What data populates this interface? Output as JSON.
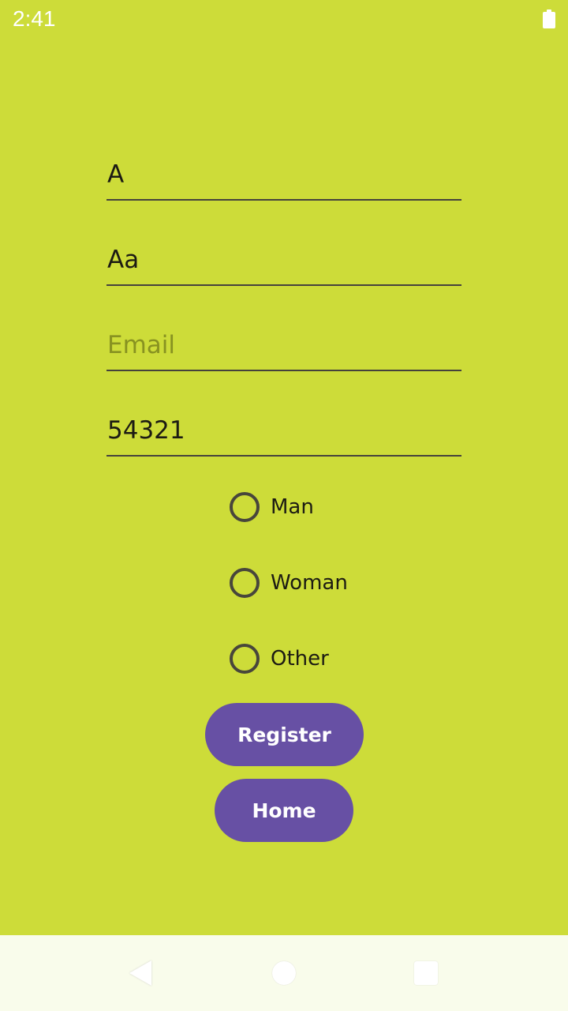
{
  "status_bar": {
    "time": "2:41",
    "battery_icon": "battery-full-icon"
  },
  "form": {
    "fields": [
      {
        "name": "first-name",
        "value": "A",
        "placeholder": ""
      },
      {
        "name": "last-name",
        "value": "Aa",
        "placeholder": ""
      },
      {
        "name": "email",
        "value": "",
        "placeholder": "Email"
      },
      {
        "name": "password",
        "value": "54321",
        "placeholder": ""
      }
    ],
    "gender_options": [
      {
        "label": "Man",
        "selected": false
      },
      {
        "label": "Woman",
        "selected": false
      },
      {
        "label": "Other",
        "selected": false
      }
    ],
    "register_label": "Register",
    "home_label": "Home"
  },
  "nav_bar": {
    "back_icon": "back-triangle-icon",
    "home_icon": "home-circle-icon",
    "recents_icon": "recents-square-icon"
  },
  "colors": {
    "background": "#cddc39",
    "button": "#6750a4",
    "button_text": "#ffffff",
    "nav_bar": "#f9fceb",
    "underline": "#45423c",
    "placeholder": "#889221"
  }
}
